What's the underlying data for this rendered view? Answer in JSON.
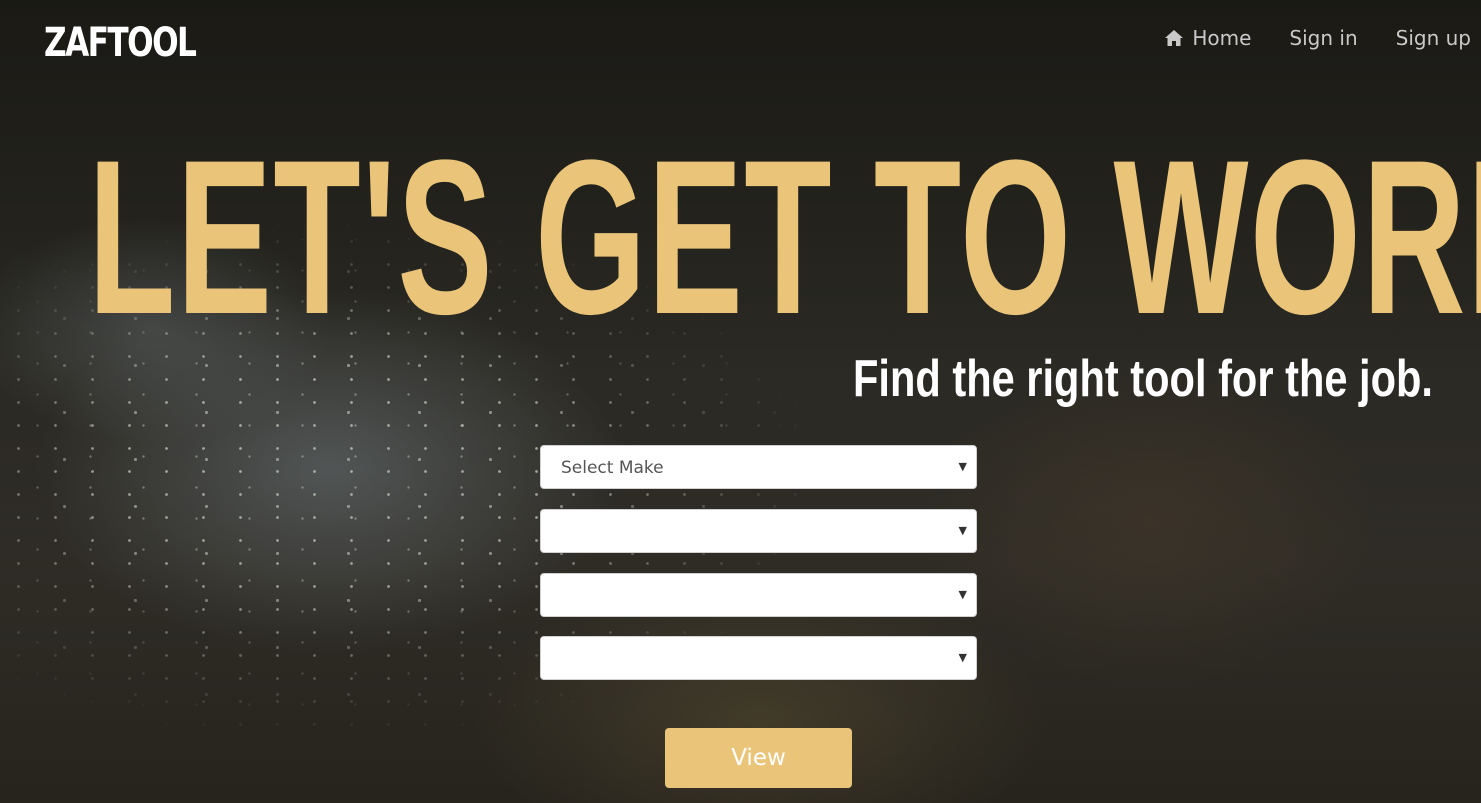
{
  "brand": {
    "name": "ZAFTOOL"
  },
  "nav": {
    "items": [
      {
        "label": "Home",
        "icon": "home-icon"
      },
      {
        "label": "Sign in"
      },
      {
        "label": "Sign up"
      }
    ]
  },
  "hero": {
    "headline": "LET'S GET TO WORK.",
    "subheadline": "Find the right tool for the job."
  },
  "form": {
    "make_select": {
      "value": "Select Make"
    },
    "select_2": {
      "value": ""
    },
    "select_3": {
      "value": ""
    },
    "select_4": {
      "value": ""
    },
    "view_label": "View"
  },
  "colors": {
    "accent": "#e9c479",
    "nav_text": "#c9c9c9",
    "headline": "#e9c479",
    "subheadline": "#ffffff"
  }
}
